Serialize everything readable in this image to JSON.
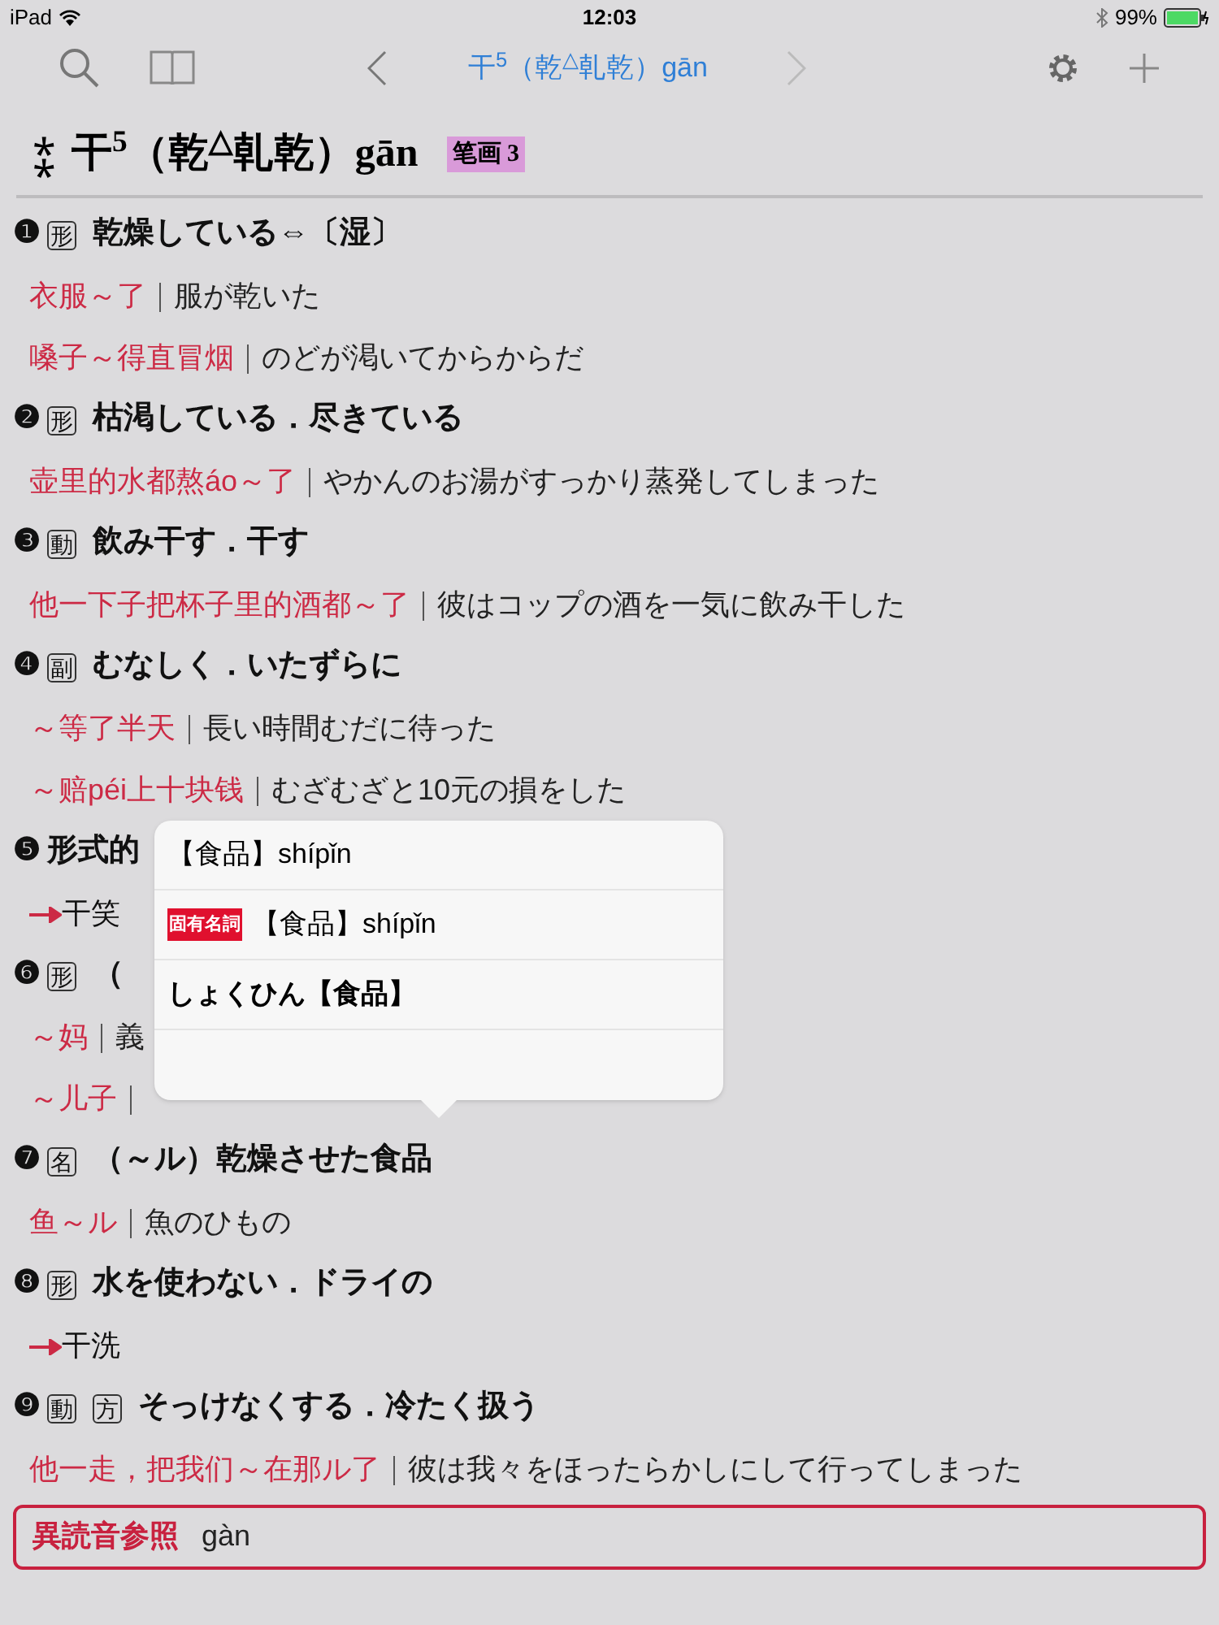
{
  "status_bar": {
    "device": "iPad",
    "time": "12:03",
    "battery": "99%"
  },
  "nav": {
    "title": "干$^{5}$（乾$^{△}$乹乾）gān"
  },
  "entry": {
    "mark": "⁑",
    "headword": "干$^{5}$（乾$^{△}$乹乾）gān",
    "strokes": "笔画 3"
  },
  "senses": [
    {
      "num": "❶",
      "pos": [
        "形"
      ],
      "definition": "乾燥している⇔〔湿〕",
      "examples": [
        {
          "kind": "example",
          "zh": "衣服～了",
          "ja": "服が乾いた"
        },
        {
          "kind": "example",
          "zh": "嗓子～得直冒烟",
          "ja": "のどが渇いてからからだ"
        }
      ]
    },
    {
      "num": "❷",
      "pos": [
        "形"
      ],
      "definition": "枯渇している．尽きている",
      "examples": [
        {
          "kind": "example",
          "zh": "壶里的水都熬áo～了",
          "ja": "やかんのお湯がすっかり蒸発してしまった"
        }
      ]
    },
    {
      "num": "❸",
      "pos": [
        "動"
      ],
      "definition": "飲み干す．干す",
      "examples": [
        {
          "kind": "example",
          "zh": "他一下子把杯子里的酒都～了",
          "ja": "彼はコップの酒を一気に飲み干した"
        }
      ]
    },
    {
      "num": "❹",
      "pos": [
        "副"
      ],
      "definition": "むなしく．いたずらに",
      "examples": [
        {
          "kind": "example",
          "zh": "～等了半天",
          "ja": "長い時間むだに待った"
        },
        {
          "kind": "example",
          "zh": "～赔péi上十块钱",
          "ja": "むざむざと10元の損をした"
        }
      ]
    },
    {
      "num": "❺",
      "definition": "形式的",
      "examples": [
        {
          "kind": "crossref",
          "zh": "干笑"
        }
      ]
    },
    {
      "num": "❻",
      "pos": [
        "形"
      ],
      "definition": "（",
      "examples": [
        {
          "kind": "example",
          "zh": "～妈",
          "ja": "義"
        },
        {
          "kind": "example",
          "zh": "～儿子"
        }
      ]
    },
    {
      "num": "❼",
      "pos": [
        "名"
      ],
      "definition": "（～ル）乾燥させた食品",
      "examples": [
        {
          "kind": "example",
          "zh": "鱼～ル",
          "ja": "魚のひもの"
        }
      ]
    },
    {
      "num": "❽",
      "pos": [
        "形"
      ],
      "definition": "水を使わない．ドライの",
      "examples": [
        {
          "kind": "crossref",
          "zh": "干洗"
        }
      ]
    },
    {
      "num": "❾",
      "pos": [
        "動",
        "方"
      ],
      "definition": "そっけなくする．冷たく扱う",
      "examples": [
        {
          "kind": "example",
          "zh": "他一走，把我们～在那ル了",
          "ja": "彼は我々をほったらかしにして行ってしまった"
        }
      ]
    }
  ],
  "footer": {
    "label": "異読音参照",
    "reading": "gàn"
  },
  "popover": {
    "items": [
      {
        "text": "【食品】shípǐn",
        "bold": false
      },
      {
        "tag": "固有名詞",
        "text": "【食品】shípǐn",
        "bold": false
      },
      {
        "text": "しょくひん【食品】",
        "bold": true
      }
    ]
  }
}
